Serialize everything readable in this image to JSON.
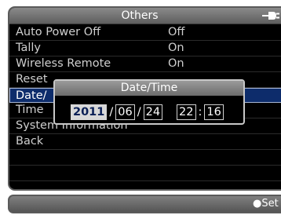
{
  "header": {
    "title": "Others"
  },
  "menu": {
    "items": [
      {
        "label": "Auto Power Off",
        "value": "Off"
      },
      {
        "label": "Tally",
        "value": "On"
      },
      {
        "label": "Wireless Remote",
        "value": "On"
      },
      {
        "label": "Reset",
        "value": ""
      },
      {
        "label": "Date/",
        "value": ""
      },
      {
        "label": "Time",
        "value": ""
      },
      {
        "label": "System Information",
        "value": ""
      },
      {
        "label": "Back",
        "value": ""
      }
    ]
  },
  "popup": {
    "title": "Date/Time",
    "year": "2011",
    "month": "06",
    "day": "24",
    "hour": "22",
    "minute": "16",
    "date_separator": "/",
    "time_separator": ":"
  },
  "footer": {
    "hint": "●Set"
  },
  "icons": {
    "power": "plug-icon"
  }
}
